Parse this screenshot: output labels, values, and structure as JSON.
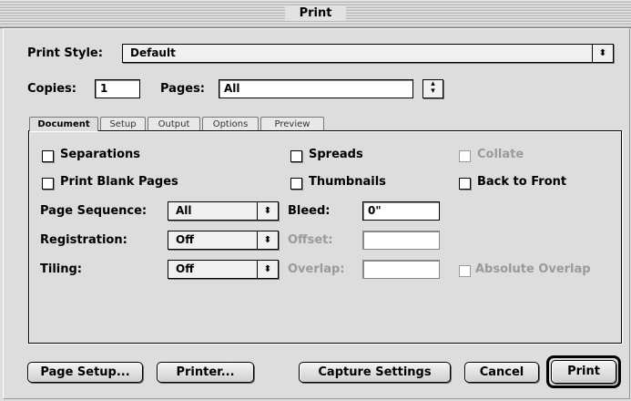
{
  "window": {
    "title": "Print"
  },
  "print_style": {
    "label": "Print Style:",
    "value": "Default",
    "arrow": "⬍"
  },
  "copies": {
    "label": "Copies:",
    "value": "1"
  },
  "pages": {
    "label": "Pages:",
    "value": "All"
  },
  "tabs": [
    {
      "label": "Document",
      "active": true
    },
    {
      "label": "Setup"
    },
    {
      "label": "Output"
    },
    {
      "label": "Options"
    },
    {
      "label": "Preview"
    }
  ],
  "document": {
    "separations": "Separations",
    "print_blank_pages": "Print Blank Pages",
    "spreads": "Spreads",
    "thumbnails": "Thumbnails",
    "collate": "Collate",
    "back_to_front": "Back to Front",
    "page_sequence": {
      "label": "Page Sequence:",
      "value": "All"
    },
    "registration": {
      "label": "Registration:",
      "value": "Off"
    },
    "tiling": {
      "label": "Tiling:",
      "value": "Off"
    },
    "bleed": {
      "label": "Bleed:",
      "value": "0\""
    },
    "offset": {
      "label": "Offset:",
      "value": ""
    },
    "overlap": {
      "label": "Overlap:",
      "value": ""
    },
    "absolute_overlap": "Absolute Overlap"
  },
  "buttons": {
    "page_setup": "Page Setup...",
    "printer": "Printer...",
    "capture_settings": "Capture Settings",
    "cancel": "Cancel",
    "print": "Print"
  }
}
